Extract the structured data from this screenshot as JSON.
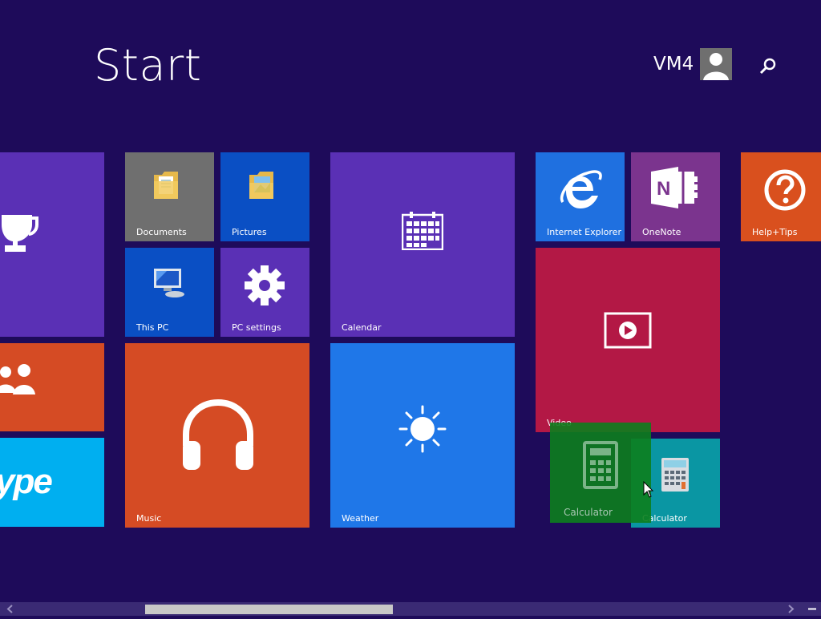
{
  "header": {
    "title": "Start",
    "user_name": "VM4"
  },
  "colors": {
    "background": "#1e0b5a",
    "purple": "#5a30b5",
    "orange": "#d54b24",
    "skype": "#00aff0",
    "gray": "#6f6f6f",
    "blue_dark": "#0a4fc4",
    "weather": "#1f77e8",
    "ie": "#1f70e0",
    "onenote": "#7b348e",
    "video": "#b31845",
    "help": "#d9501e",
    "calc_drag": "#0d7f1e",
    "calc_tile": "#0a96a3"
  },
  "tiles": {
    "documents": "Documents",
    "pictures": "Pictures",
    "this_pc": "This PC",
    "pc_settings": "PC settings",
    "calendar": "Calendar",
    "music": "Music",
    "weather": "Weather",
    "internet_explorer": "Internet Explorer",
    "onenote": "OneNote",
    "help_tips": "Help+Tips",
    "video": "Video",
    "calculator_dragging": "Calculator",
    "calculator": "Calculator"
  },
  "icons": {
    "search": "search-icon",
    "avatar": "user-avatar-icon",
    "trophy": "trophy-icon",
    "people": "people-icon",
    "skype": "skype-logo",
    "folder": "folder-icon",
    "computer": "computer-icon",
    "gear": "gear-icon",
    "calendar": "calendar-icon",
    "headphones": "headphones-icon",
    "sun": "sun-icon",
    "ie": "internet-explorer-icon",
    "onenote": "onenote-icon",
    "help": "question-icon",
    "video": "video-play-icon",
    "calculator": "calculator-icon",
    "cursor": "mouse-cursor"
  },
  "skype_text": "ype"
}
